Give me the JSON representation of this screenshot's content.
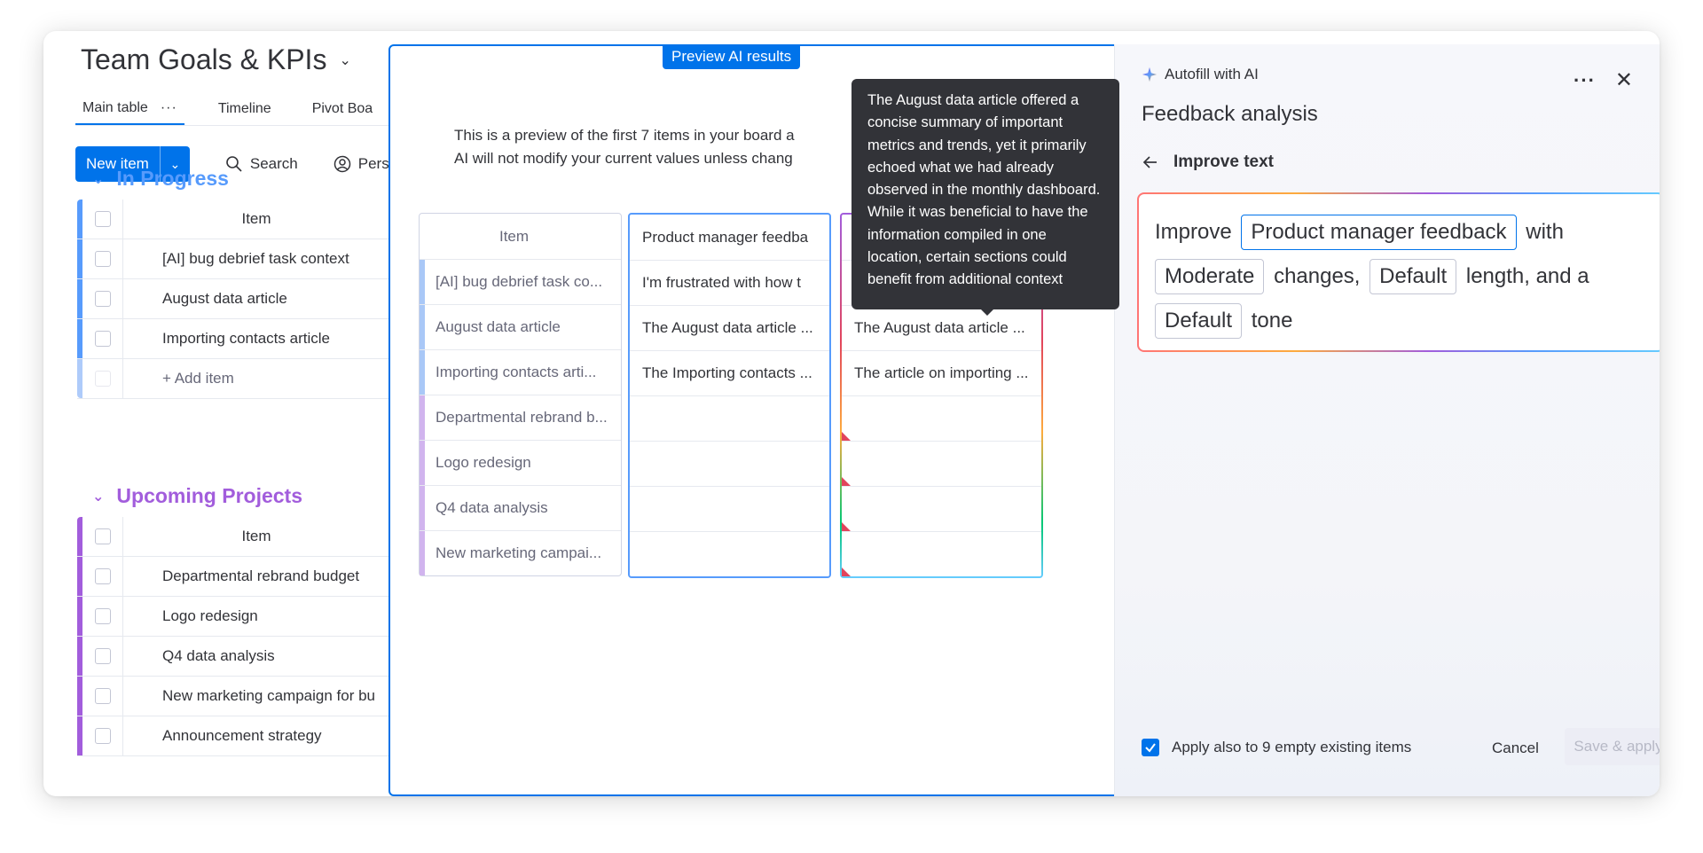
{
  "board": {
    "title": "Team Goals & KPIs",
    "views": [
      "Main table",
      "Timeline",
      "Pivot Boa"
    ],
    "views_more": "···",
    "new_item_label": "New item",
    "search_label": "Search",
    "person_label": "Perso"
  },
  "groups": [
    {
      "title": "In Progress",
      "color": "#579bfc",
      "header": "Item",
      "items": [
        "[AI] bug debrief task context",
        "August data article",
        "Importing contacts article"
      ],
      "add_label": "+ Add item"
    },
    {
      "title": "Upcoming Projects",
      "color": "#a25ddc",
      "header": "Item",
      "items": [
        "Departmental rebrand budget",
        "Logo redesign",
        "Q4 data analysis",
        "New marketing campaign for bu",
        "Announcement strategy"
      ]
    }
  ],
  "preview": {
    "badge": "Preview AI results",
    "desc_line1": "This is a preview of the first 7 items in your board a",
    "desc_line2": "AI will not modify your current values unless chang",
    "items_header": "Item",
    "items": [
      "[AI] bug debrief task co...",
      "August data article",
      "Importing contacts arti...",
      "Departmental rebrand b...",
      "Logo redesign",
      "Q4 data analysis",
      "New marketing campai..."
    ],
    "source_header": "Product manager feedba",
    "source_values": [
      "I'm frustrated with how t",
      "The August data article ...",
      "The Importing contacts ..."
    ],
    "output_values": [
      "The August data article ...",
      "The article on importing ..."
    ]
  },
  "tooltip": {
    "text": "The August data article offered a concise summary of important metrics and trends, yet it primarily echoed what we had already observed in the monthly dashboard. While it was beneficial to have the information compiled in one location, certain sections could benefit from additional context"
  },
  "panel": {
    "subtitle": "Autofill with AI",
    "title": "Feedback analysis",
    "more_label": "···",
    "close_label": "✕",
    "back_label": "Improve text",
    "prompt": {
      "w_improve": "Improve",
      "column_chip": "Product manager feedback",
      "w_with": "with",
      "changes_chip": "Moderate",
      "w_changes": "changes,",
      "length_chip": "Default",
      "w_length": "length, and a",
      "tone_chip": "Default",
      "w_tone": "tone"
    },
    "apply_also": "Apply also to 9 empty existing items",
    "cancel": "Cancel",
    "save": "Save & apply"
  }
}
